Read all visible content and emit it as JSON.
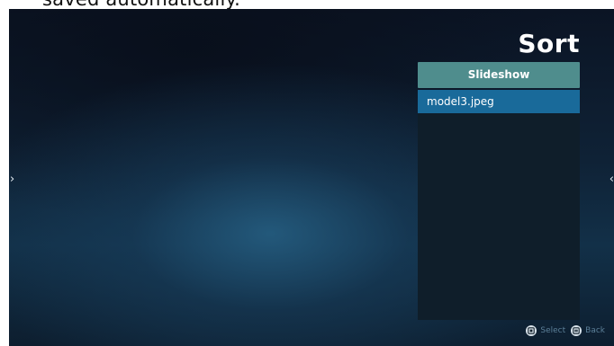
{
  "caption": "saved automatically.",
  "screen": {
    "title": "Sort",
    "nav": {
      "left_arrow_glyph": "›",
      "right_arrow_glyph": "‹"
    },
    "mode_button": {
      "label": "Slideshow"
    },
    "file_list": {
      "items": [
        {
          "label": "model3.jpeg",
          "selected": true
        }
      ]
    },
    "hints": {
      "select_label": "Select",
      "back_label": "Back",
      "select_icon": "ok-remote-key-icon",
      "back_icon": "back-remote-key-icon"
    }
  },
  "colors": {
    "mode_button_bg": "#4f8d8d",
    "selected_item_bg": "#196a9a",
    "list_bg": "#0f1e2a",
    "hint_text": "#5c7f98"
  }
}
